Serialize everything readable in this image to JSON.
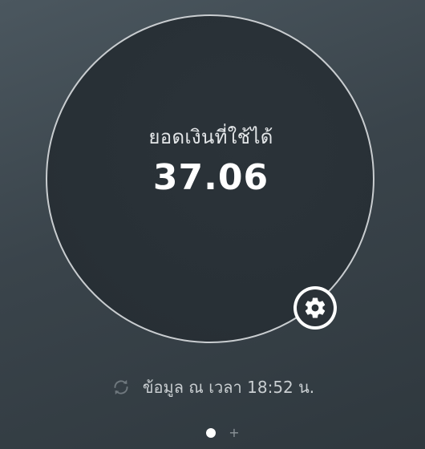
{
  "balance": {
    "label": "ยอดเงินที่ใช้ได้",
    "amount": "37.06"
  },
  "status": {
    "update_text": "ข้อมูล ณ เวลา 18:52 น."
  },
  "pager": {
    "add_symbol": "+",
    "current_page": 1
  },
  "icons": {
    "settings": "gear-icon",
    "refresh": "refresh-icon"
  },
  "colors": {
    "background_top": "#4b575f",
    "background_bottom": "#2f383e",
    "circle_fill": "#283036",
    "circle_border": "#c9cdd0",
    "text_primary": "#ffffff",
    "text_secondary": "#c9ced1"
  }
}
